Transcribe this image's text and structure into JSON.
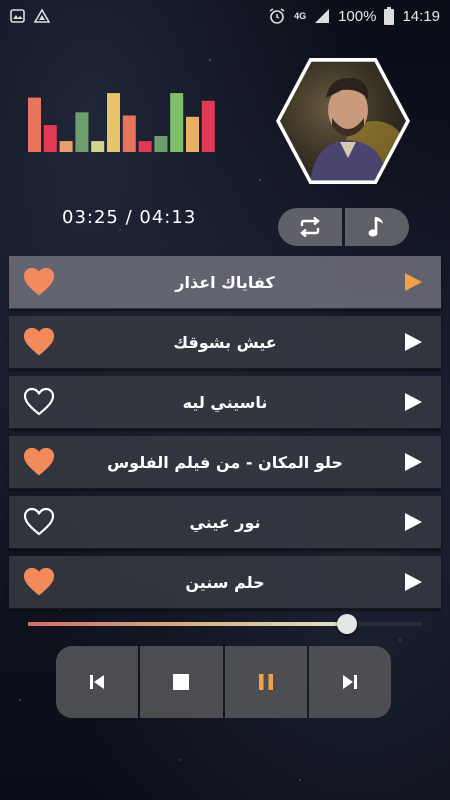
{
  "status_bar": {
    "signal_type": "4G",
    "battery": "100%",
    "time": "14:19"
  },
  "player": {
    "elapsed": "03:25",
    "duration": "04:13",
    "progress_fraction": 0.81,
    "equalizer_levels": [
      0.85,
      0.42,
      0.17,
      0.62,
      0.17,
      0.92,
      0.57,
      0.17,
      0.25,
      0.92,
      0.55,
      0.8
    ],
    "equalizer_colors": [
      "#e8745e",
      "#e03a56",
      "#e8a06b",
      "#6f9e6e",
      "#cfd68a",
      "#e8c46b",
      "#e8745e",
      "#e03a56",
      "#6f9e6e",
      "#7fbf6a",
      "#e8b060",
      "#e03a56"
    ]
  },
  "colors": {
    "accent": "#f28a5b",
    "play_active": "#f2a04a",
    "pause": "#f2a04a",
    "heart_filled": "#f28a5b"
  },
  "tracks": [
    {
      "title": "كفاياك اعذار",
      "favorite": true,
      "active": true
    },
    {
      "title": "عيش بشوقك",
      "favorite": true,
      "active": false
    },
    {
      "title": "ناسيني ليه",
      "favorite": false,
      "active": false
    },
    {
      "title": "حلو المكان - من فيلم الفلوس",
      "favorite": true,
      "active": false
    },
    {
      "title": "نور عيني",
      "favorite": false,
      "active": false
    },
    {
      "title": "حلم سنين",
      "favorite": true,
      "active": false
    }
  ],
  "icons": {
    "repeat": "repeat-icon",
    "playlist": "music-note-icon",
    "prev": "skip-previous-icon",
    "stop": "stop-icon",
    "pause": "pause-icon",
    "next": "skip-next-icon"
  }
}
